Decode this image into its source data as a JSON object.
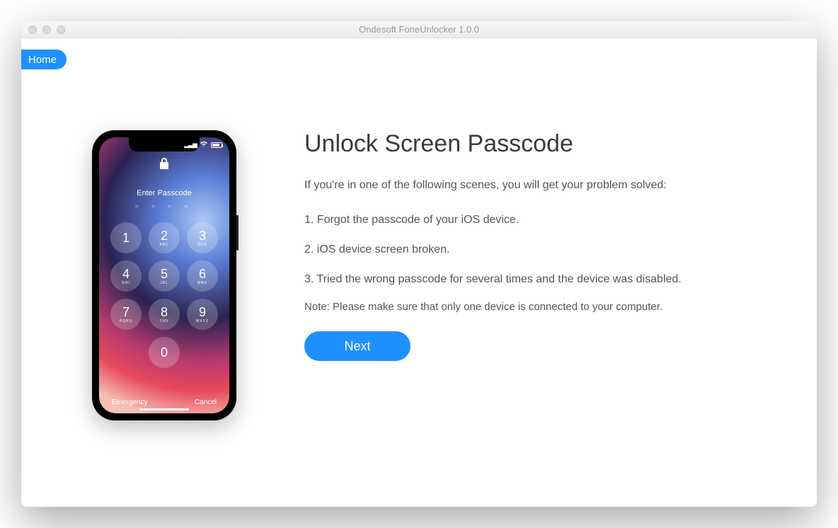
{
  "window": {
    "title": "Ondesoft FoneUnlocker 1.0.0"
  },
  "nav": {
    "home_label": "Home"
  },
  "phone": {
    "enter_passcode": "Enter Passcode",
    "emergency": "Emergency",
    "cancel": "Cancel",
    "keys": [
      {
        "num": "1",
        "sub": ""
      },
      {
        "num": "2",
        "sub": "ABC"
      },
      {
        "num": "3",
        "sub": "DEF"
      },
      {
        "num": "4",
        "sub": "GHI"
      },
      {
        "num": "5",
        "sub": "JKL"
      },
      {
        "num": "6",
        "sub": "MNO"
      },
      {
        "num": "7",
        "sub": "PQRS"
      },
      {
        "num": "8",
        "sub": "TUV"
      },
      {
        "num": "9",
        "sub": "WXYZ"
      }
    ],
    "zero": {
      "num": "0",
      "sub": ""
    }
  },
  "main": {
    "heading": "Unlock Screen Passcode",
    "intro": "If you're in one of the following scenes, you will get your problem solved:",
    "scenario_1": "1. Forgot the passcode of your iOS device.",
    "scenario_2": "2. iOS device screen broken.",
    "scenario_3": "3. Tried the wrong passcode for several times and the device was disabled.",
    "note": "Note: Please make sure that only one device is connected to your computer.",
    "next_label": "Next"
  }
}
